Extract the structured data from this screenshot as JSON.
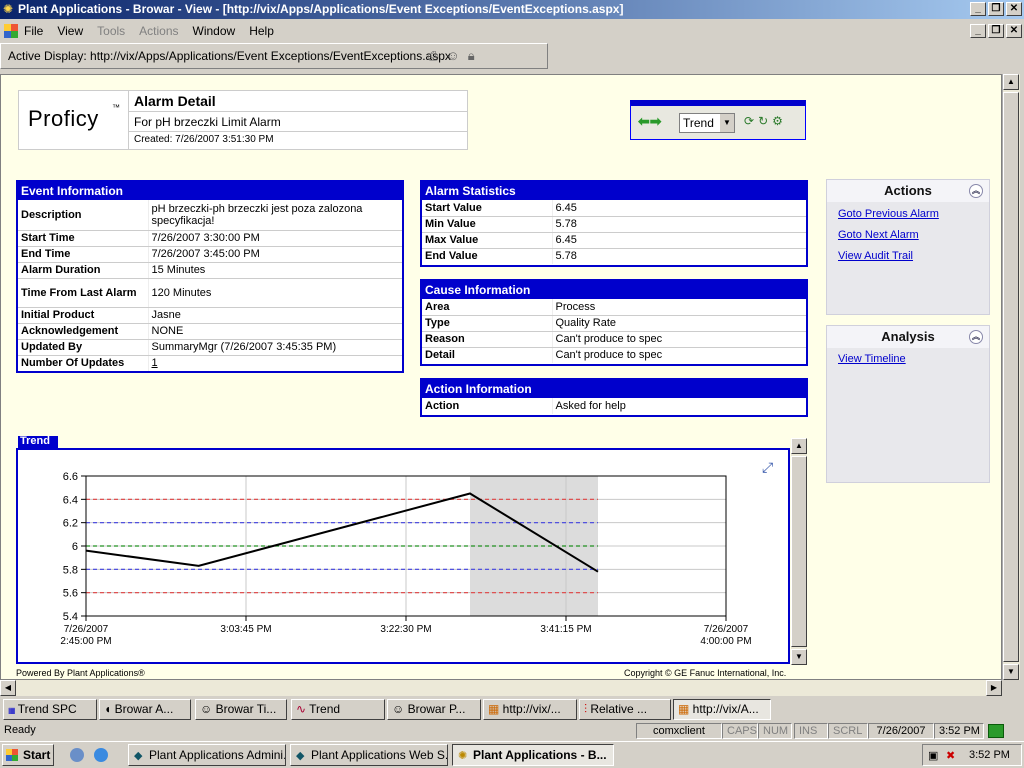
{
  "window": {
    "title": "Plant Applications - Browar - View - [http://vix/Apps/Applications/Event Exceptions/EventExceptions.aspx]"
  },
  "menu": {
    "items": [
      "File",
      "View",
      "Tools",
      "Actions",
      "Window",
      "Help"
    ],
    "disabled": [
      "Tools",
      "Actions"
    ]
  },
  "address": {
    "label": "Active Display: http://vix/Apps/Applications/Event Exceptions/EventExceptions.aspx"
  },
  "header": {
    "logo": "Proficy",
    "logo_tm": "™",
    "title": "Alarm Detail",
    "subtitle": "For pH brzeczki Limit Alarm",
    "created": "Created: 7/26/2007 3:51:30 PM"
  },
  "nav": {
    "selected": "Trend"
  },
  "event_info": {
    "title": "Event Information",
    "rows": [
      {
        "k": "Description",
        "v": "pH brzeczki-ph brzeczki jest poza zalozona specyfikacja!"
      },
      {
        "k": "Start Time",
        "v": "7/26/2007 3:30:00 PM"
      },
      {
        "k": "End Time",
        "v": "7/26/2007 3:45:00 PM"
      },
      {
        "k": "Alarm Duration",
        "v": "15 Minutes"
      },
      {
        "k": "Time From Last Alarm",
        "v": "120 Minutes"
      },
      {
        "k": "Initial Product",
        "v": "Jasne"
      },
      {
        "k": "Acknowledgement",
        "v": "NONE"
      },
      {
        "k": "Updated By",
        "v": "SummaryMgr (7/26/2007 3:45:35 PM)"
      },
      {
        "k": "Number Of Updates",
        "v": "1"
      }
    ]
  },
  "alarm_stats": {
    "title": "Alarm Statistics",
    "rows": [
      {
        "k": "Start Value",
        "v": "6.45"
      },
      {
        "k": "Min Value",
        "v": "5.78"
      },
      {
        "k": "Max Value",
        "v": "6.45"
      },
      {
        "k": "End Value",
        "v": "5.78"
      }
    ]
  },
  "cause_info": {
    "title": "Cause Information",
    "rows": [
      {
        "k": "Area",
        "v": "Process"
      },
      {
        "k": "Type",
        "v": "Quality Rate"
      },
      {
        "k": "Reason",
        "v": "Can't produce to spec"
      },
      {
        "k": "Detail",
        "v": "Can't produce to spec"
      }
    ]
  },
  "action_info": {
    "title": "Action Information",
    "rows": [
      {
        "k": "Action",
        "v": "Asked for help"
      }
    ]
  },
  "actions": {
    "title": "Actions",
    "links": [
      "Goto Previous Alarm",
      "Goto Next Alarm",
      "View Audit Trail"
    ]
  },
  "analysis": {
    "title": "Analysis",
    "links": [
      "View Timeline"
    ]
  },
  "trend": {
    "tab": "Trend"
  },
  "chart_data": {
    "type": "line",
    "title": "",
    "xlabel": "",
    "ylabel": "",
    "ylim": [
      5.4,
      6.6
    ],
    "yticks": [
      "6.6",
      "6.4",
      "6.2",
      "6",
      "5.8",
      "5.6",
      "5.4"
    ],
    "xticks": [
      {
        "l1": "7/26/2007",
        "l2": "2:45:00 PM"
      },
      {
        "l1": "3:03:45 PM",
        "l2": ""
      },
      {
        "l1": "3:22:30 PM",
        "l2": ""
      },
      {
        "l1": "3:41:15 PM",
        "l2": ""
      },
      {
        "l1": "7/26/2007",
        "l2": "4:00:00 PM"
      }
    ],
    "x_range_min": [
      0,
      75
    ],
    "alarm_window_min": [
      45,
      60
    ],
    "series": [
      {
        "x_min": [
          0,
          13.2,
          45,
          60
        ],
        "values": [
          5.96,
          5.83,
          6.45,
          5.78
        ],
        "color": "#000000"
      }
    ],
    "limit_lines": [
      {
        "value": 6.4,
        "color": "#e04040"
      },
      {
        "value": 6.2,
        "color": "#4040e0"
      },
      {
        "value": 6.0,
        "color": "#209020"
      },
      {
        "value": 5.8,
        "color": "#4040e0"
      },
      {
        "value": 5.6,
        "color": "#e04040"
      }
    ],
    "limit_end_min": 60
  },
  "footer": {
    "left": "Powered By Plant Applications®",
    "right": "Copyright © GE Fanuc International, Inc."
  },
  "tasks": [
    "Trend SPC",
    "Browar A...",
    "Browar Ti...",
    "Trend",
    "Browar P...",
    "http://vix/...",
    "Relative ...",
    "http://vix/A..."
  ],
  "status": {
    "ready": "Ready",
    "user": "comxclient",
    "caps": "CAPS",
    "num": "NUM",
    "ins": "INS",
    "scrl": "SCRL",
    "date": "7/26/2007",
    "time": "3:52 PM"
  },
  "taskbar": {
    "start": "Start",
    "items": [
      "Plant Applications Admini...",
      "Plant Applications Web S...",
      "Plant Applications - B..."
    ],
    "clock": "3:52 PM"
  }
}
